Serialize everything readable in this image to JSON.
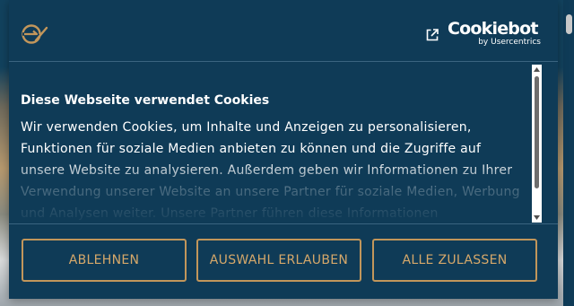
{
  "dialog": {
    "header": {
      "brand_logo_icon": "brand-logo-icon",
      "external_link_icon": "external-link-icon",
      "provider_name": "Cookiebot",
      "provider_byline": "by Usercentrics"
    },
    "content": {
      "title": "Diese Webseite verwendet Cookies",
      "text": "Wir verwenden Cookies, um Inhalte und Anzeigen zu personalisieren, Funktionen für soziale Medien anbieten zu können und die Zugriffe auf unsere Website zu analysieren. Außerdem geben wir Informationen zu Ihrer Verwendung unserer Website an unsere Partner für soziale Medien, Werbung und Analysen weiter. Unsere Partner führen diese Informationen"
    },
    "buttons": {
      "decline": "ABLEHNEN",
      "allow_selection": "AUSWAHL ERLAUBEN",
      "allow_all": "ALLE ZULASSEN"
    }
  },
  "colors": {
    "background": "#0f3b57",
    "text": "#ffffff",
    "accent": "#c2965b",
    "button_text": "#d6a86a",
    "divider": "#3a6480"
  }
}
